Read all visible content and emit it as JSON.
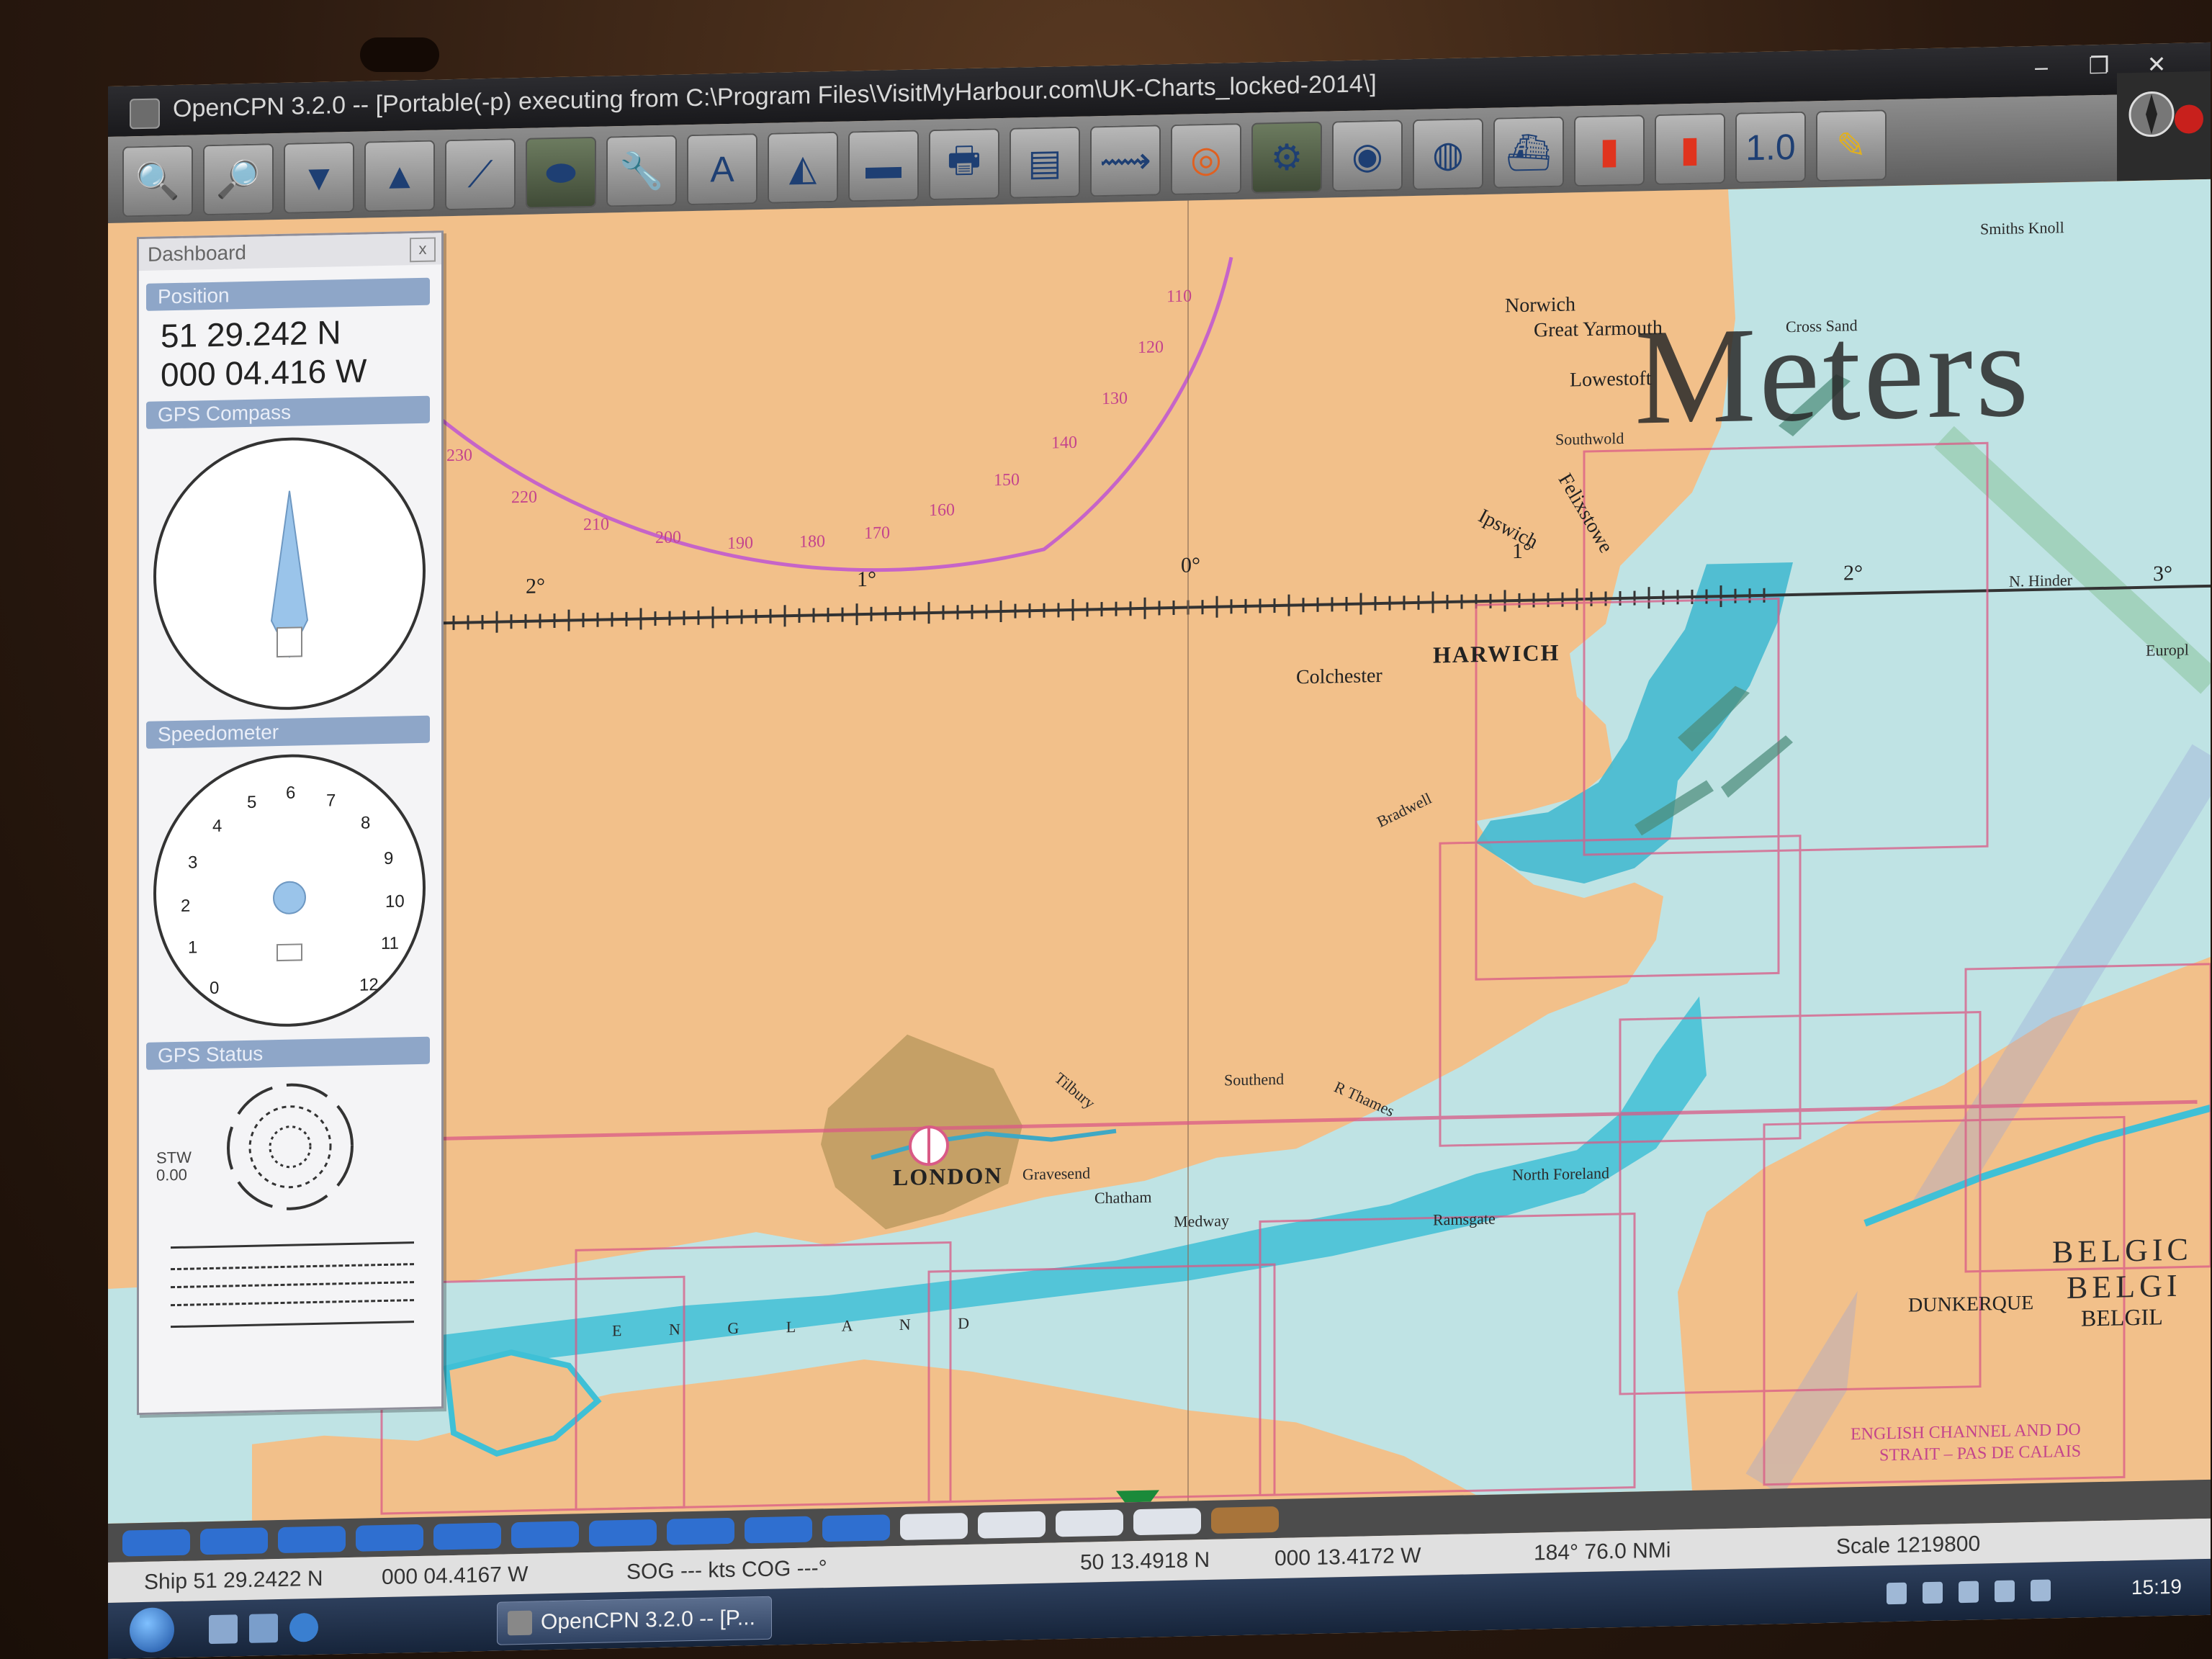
{
  "window": {
    "title": "OpenCPN 3.2.0 -- [Portable(-p) executing from C:\\Program Files\\VisitMyHarbour.com\\UK-Charts_locked-2014\\]",
    "minimize": "–",
    "maximize": "❐",
    "close": "✕"
  },
  "toolbar": {
    "tools": [
      {
        "name": "zoom-in",
        "icon": "🔍"
      },
      {
        "name": "zoom-out",
        "icon": "🔎"
      },
      {
        "name": "chart-quilt",
        "icon": "▼"
      },
      {
        "name": "follow-ship",
        "icon": "▲"
      },
      {
        "name": "route",
        "icon": "⟋"
      },
      {
        "name": "ship-track",
        "icon": "⬬"
      },
      {
        "name": "toolbox",
        "icon": "🔧"
      },
      {
        "name": "text-toggle",
        "icon": "A"
      },
      {
        "name": "current",
        "icon": "◭"
      },
      {
        "name": "tide",
        "icon": "▬"
      },
      {
        "name": "print",
        "icon": "🖶"
      },
      {
        "name": "route-manager",
        "icon": "▤"
      },
      {
        "name": "track-toggle",
        "icon": "⟿"
      },
      {
        "name": "man-overboard",
        "icon": "◎"
      },
      {
        "name": "plugin-grib",
        "icon": "⚙"
      },
      {
        "name": "plugin-earth",
        "icon": "◉"
      },
      {
        "name": "plugin-globe",
        "icon": "◍"
      },
      {
        "name": "plugin-ais",
        "icon": "⛴"
      },
      {
        "name": "plugin-red-1",
        "icon": "▮"
      },
      {
        "name": "plugin-red-2",
        "icon": "▮"
      },
      {
        "name": "plugin-1-0",
        "icon": "1.0"
      },
      {
        "name": "plugin-pencil",
        "icon": "✎"
      }
    ]
  },
  "chart": {
    "meters_label": "Meters",
    "longitude_labels": [
      "2°",
      "1°",
      "0°",
      "1°",
      "2°",
      "3°"
    ],
    "compass_rose_numbers": [
      "230",
      "220",
      "210",
      "200",
      "190",
      "180",
      "170",
      "160",
      "150",
      "140",
      "130",
      "120",
      "110"
    ],
    "places": {
      "norwich": "Norwich",
      "great_yarmouth": "Great Yarmouth",
      "lowestoft": "Lowestoft",
      "southwold": "Southwold",
      "ipswich": "Ipswich",
      "felixstowe": "Felixstowe",
      "harwich": "HARWICH",
      "colchester": "Colchester",
      "london": "LONDON",
      "gravesend": "Gravesend",
      "chatham": "Chatham",
      "medway": "Medway",
      "southend": "Southend",
      "thames": "R Thames",
      "tilbury": "Tilbury",
      "ramsgate": "Ramsgate",
      "north_foreland": "North Foreland",
      "england": "E N G L A N D",
      "dunkerque": "DUNKERQUE",
      "belgium_1": "BELGIC",
      "belgium_2": "BELGI",
      "belgium_3": "BELGIL",
      "smiths_knoll": "Smiths Knoll",
      "cross_sand": "Cross Sand",
      "n_hinder": "N. Hinder",
      "europlatform": "Europl",
      "channel_title": "ENGLISH CHANNEL AND DO",
      "channel_sub": "STRAIT – PAS DE CALAIS",
      "blackwater": "Bradwell"
    }
  },
  "dashboard": {
    "title": "Dashboard",
    "close": "x",
    "position_header": "Position",
    "lat": "51 29.242 N",
    "lon": "000 04.416 W",
    "compass_header": "GPS Compass",
    "speedometer_header": "Speedometer",
    "speed_numbers": [
      "0",
      "1",
      "2",
      "3",
      "4",
      "5",
      "6",
      "7",
      "8",
      "9",
      "10",
      "11",
      "12"
    ],
    "stw_label": "STW",
    "stw_value": "0.00",
    "gps_status_header": "GPS Status"
  },
  "status": {
    "ship": "Ship 51 29.2422 N",
    "ship_lon": "000 04.4167 W",
    "sog_cog": "SOG --- kts  COG ---°",
    "cursor_lat": "50 13.4918 N",
    "cursor_lon": "000 13.4172 W",
    "bearing_dist": "184°  76.0 NMi",
    "scale": "Scale 1219800"
  },
  "piano": {
    "keys": [
      "blue",
      "blue",
      "blue",
      "blue",
      "blue",
      "blue",
      "blue",
      "blue",
      "blue",
      "blue",
      "white",
      "white",
      "white",
      "white",
      "brown"
    ],
    "colors": {
      "blue": "#2f6fd0",
      "white": "#dfe3ea",
      "brown": "#a8743a"
    }
  },
  "taskbar": {
    "task_label": "OpenCPN 3.2.0 -- [P...",
    "clock": "15:19"
  }
}
